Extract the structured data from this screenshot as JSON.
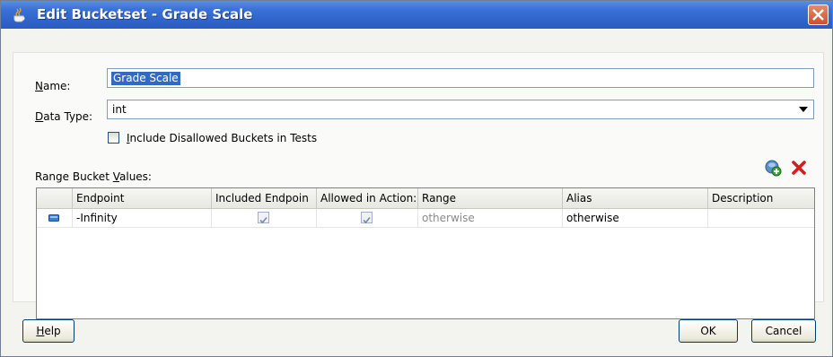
{
  "dialog": {
    "title": "Edit Bucketset - Grade Scale"
  },
  "form": {
    "name_label": "Name:",
    "name_value": "Grade Scale",
    "data_type_label": "Data Type:",
    "data_type_value": "int",
    "include_disallowed_label": "Include Disallowed Buckets in Tests",
    "include_disallowed_checked": false,
    "range_bucket_values_label": "Range Bucket Values:"
  },
  "toolbar": {
    "add_icon": "add-bucket-icon",
    "delete_icon": "delete-bucket-icon"
  },
  "table": {
    "columns": [
      "Endpoint",
      "Included Endpoin",
      "Allowed in Action:",
      "Range",
      "Alias",
      "Description"
    ],
    "rows": [
      {
        "endpoint": "-Infinity",
        "included_endpoint": true,
        "allowed_in_actions": true,
        "range": "otherwise",
        "alias": "otherwise",
        "description": ""
      }
    ]
  },
  "buttons": {
    "help": "Help",
    "ok": "OK",
    "cancel": "Cancel"
  },
  "colors": {
    "titlebar": "#2f62c8",
    "selection": "#316ac5",
    "close": "#d24e2b"
  }
}
